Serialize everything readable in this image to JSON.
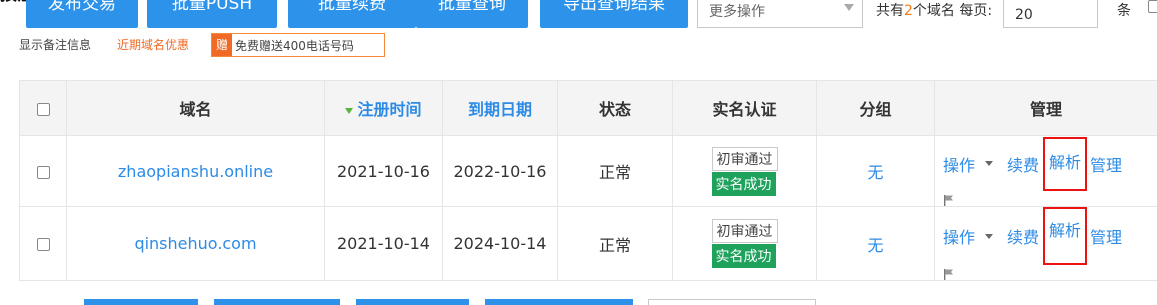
{
  "toolbar": {
    "cut_text": "按注",
    "buttons": [
      "发布交易",
      "批量PUSH",
      "批量续费",
      "批量查询",
      "导出查询结果"
    ],
    "more_select": "更多操作",
    "total_prefix": "共有",
    "total_count": "2",
    "total_suffix": "个域名 每页:",
    "page_size": "20",
    "unit": "条"
  },
  "info": {
    "show_remark": "显示备注信息",
    "recent_offer": "近期域名优惠",
    "promo_badge": "赠",
    "promo_text": "免费赠送400电话号码"
  },
  "table": {
    "headers": [
      "域名",
      "注册时间",
      "到期日期",
      "状态",
      "实名认证",
      "分组",
      "管理"
    ],
    "rows": [
      {
        "domain": "zhaopianshu.online",
        "reg_date": "2021-10-16",
        "exp_date": "2022-10-16",
        "status": "正常",
        "review": "初审通过",
        "realname": "实名成功",
        "group": "无",
        "actions": {
          "op": "操作",
          "renew": "续费",
          "dns": "解析",
          "manage": "管理"
        }
      },
      {
        "domain": "qinshehuo.com",
        "reg_date": "2021-10-14",
        "exp_date": "2024-10-14",
        "status": "正常",
        "review": "初审通过",
        "realname": "实名成功",
        "group": "无",
        "actions": {
          "op": "操作",
          "renew": "续费",
          "dns": "解析",
          "manage": "管理"
        }
      }
    ]
  },
  "colors": {
    "primary": "#2d93ea",
    "link": "#2d8be5",
    "accent": "#f06a25",
    "success": "#1fa25c",
    "highlight": "#e11111"
  },
  "icons": [
    "caret-down-icon",
    "sort-down-icon",
    "flag-icon",
    "checkbox-icon"
  ]
}
